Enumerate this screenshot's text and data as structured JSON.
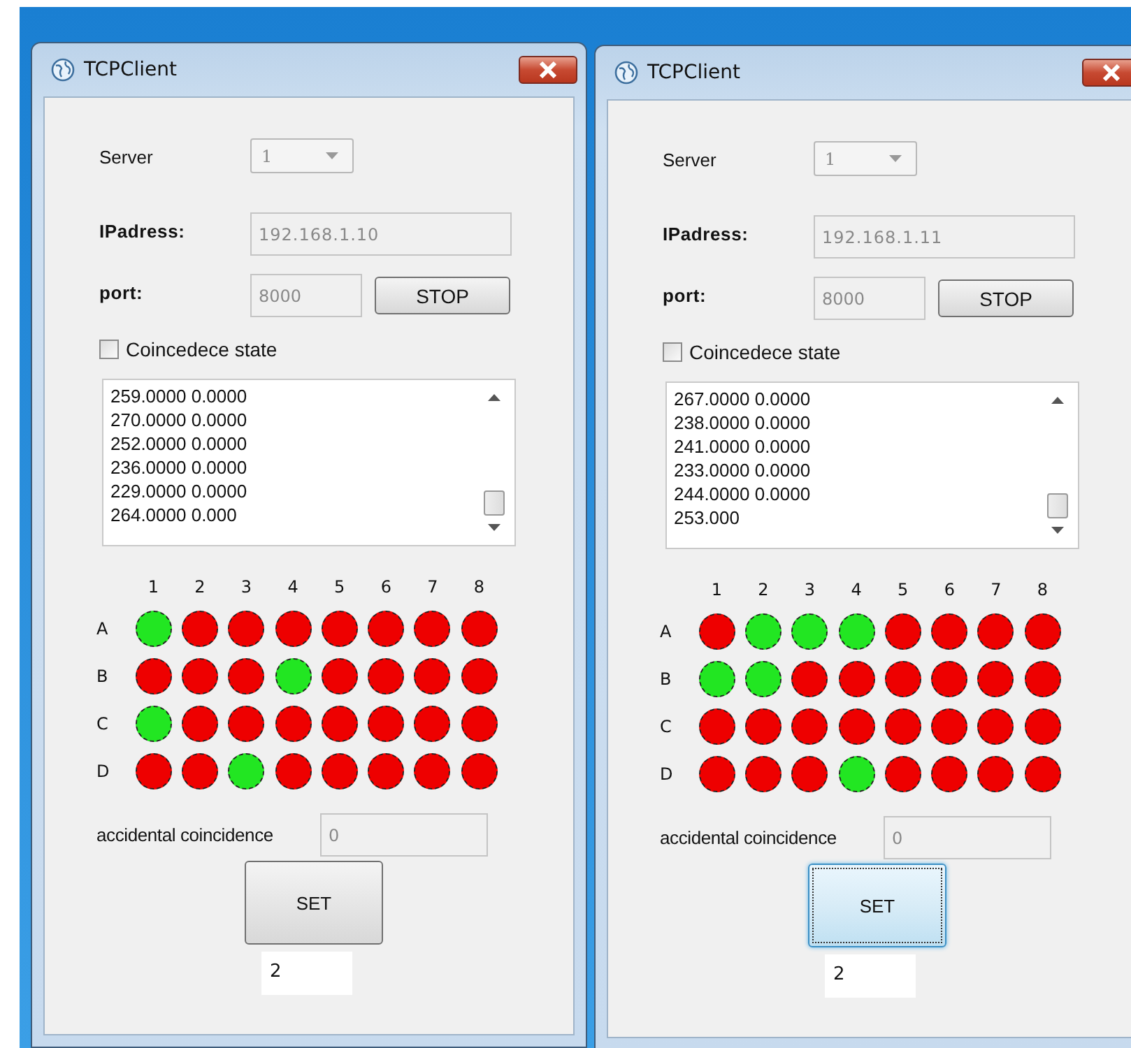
{
  "windows": [
    {
      "title": "TCPClient",
      "server": {
        "label": "Server",
        "value": "1"
      },
      "ip": {
        "label": "IPadress:",
        "value": "192.168.1.10"
      },
      "port": {
        "label": "port:",
        "value": "8000"
      },
      "stop_button": "STOP",
      "checkbox": {
        "label": "Coincedece state",
        "checked": false
      },
      "log_lines": [
        "259.0000 0.0000",
        "270.0000 0.0000",
        "252.0000 0.0000",
        "236.0000 0.0000",
        "229.0000 0.0000",
        "264.0000 0.000"
      ],
      "columns": [
        "1",
        "2",
        "3",
        "4",
        "5",
        "6",
        "7",
        "8"
      ],
      "rows": [
        {
          "label": "A",
          "lights": [
            {
              "on": true
            },
            {
              "on": false
            },
            {
              "on": false
            },
            {
              "on": false
            },
            {
              "on": false
            },
            {
              "on": false
            },
            {
              "on": false
            },
            {
              "on": false
            }
          ]
        },
        {
          "label": "B",
          "lights": [
            {
              "on": false
            },
            {
              "on": false
            },
            {
              "on": false
            },
            {
              "on": true
            },
            {
              "on": false
            },
            {
              "on": false
            },
            {
              "on": false
            },
            {
              "on": false
            }
          ]
        },
        {
          "label": "C",
          "lights": [
            {
              "on": true
            },
            {
              "on": false
            },
            {
              "on": false
            },
            {
              "on": false
            },
            {
              "on": false
            },
            {
              "on": false
            },
            {
              "on": false
            },
            {
              "on": false
            }
          ]
        },
        {
          "label": "D",
          "lights": [
            {
              "on": false
            },
            {
              "on": false
            },
            {
              "on": true
            },
            {
              "on": false
            },
            {
              "on": false
            },
            {
              "on": false
            },
            {
              "on": false
            },
            {
              "on": false
            }
          ]
        }
      ],
      "accidental": {
        "label": "accidental coincidence",
        "value": "0"
      },
      "set_button": {
        "label": "SET",
        "focused": false
      },
      "bottom_field": "2"
    },
    {
      "title": "TCPClient",
      "server": {
        "label": "Server",
        "value": "1"
      },
      "ip": {
        "label": "IPadress:",
        "value": "192.168.1.11"
      },
      "port": {
        "label": "port:",
        "value": "8000"
      },
      "stop_button": "STOP",
      "checkbox": {
        "label": "Coincedece state",
        "checked": false
      },
      "log_lines": [
        "267.0000 0.0000",
        "238.0000 0.0000",
        "241.0000 0.0000",
        "233.0000 0.0000",
        "244.0000 0.0000",
        "253.000"
      ],
      "columns": [
        "1",
        "2",
        "3",
        "4",
        "5",
        "6",
        "7",
        "8"
      ],
      "rows": [
        {
          "label": "A",
          "lights": [
            {
              "on": false
            },
            {
              "on": true
            },
            {
              "on": true
            },
            {
              "on": true
            },
            {
              "on": false
            },
            {
              "on": false
            },
            {
              "on": false
            },
            {
              "on": false
            }
          ]
        },
        {
          "label": "B",
          "lights": [
            {
              "on": true
            },
            {
              "on": true
            },
            {
              "on": false
            },
            {
              "on": false
            },
            {
              "on": false
            },
            {
              "on": false
            },
            {
              "on": false
            },
            {
              "on": false
            }
          ]
        },
        {
          "label": "C",
          "lights": [
            {
              "on": false
            },
            {
              "on": false
            },
            {
              "on": false
            },
            {
              "on": false
            },
            {
              "on": false
            },
            {
              "on": false
            },
            {
              "on": false
            },
            {
              "on": false
            }
          ]
        },
        {
          "label": "D",
          "lights": [
            {
              "on": false
            },
            {
              "on": false
            },
            {
              "on": false
            },
            {
              "on": true
            },
            {
              "on": false
            },
            {
              "on": false
            },
            {
              "on": false
            },
            {
              "on": false
            }
          ]
        }
      ],
      "accidental": {
        "label": "accidental coincidence",
        "value": "0"
      },
      "set_button": {
        "label": "SET",
        "focused": true
      },
      "bottom_field": "2"
    }
  ]
}
